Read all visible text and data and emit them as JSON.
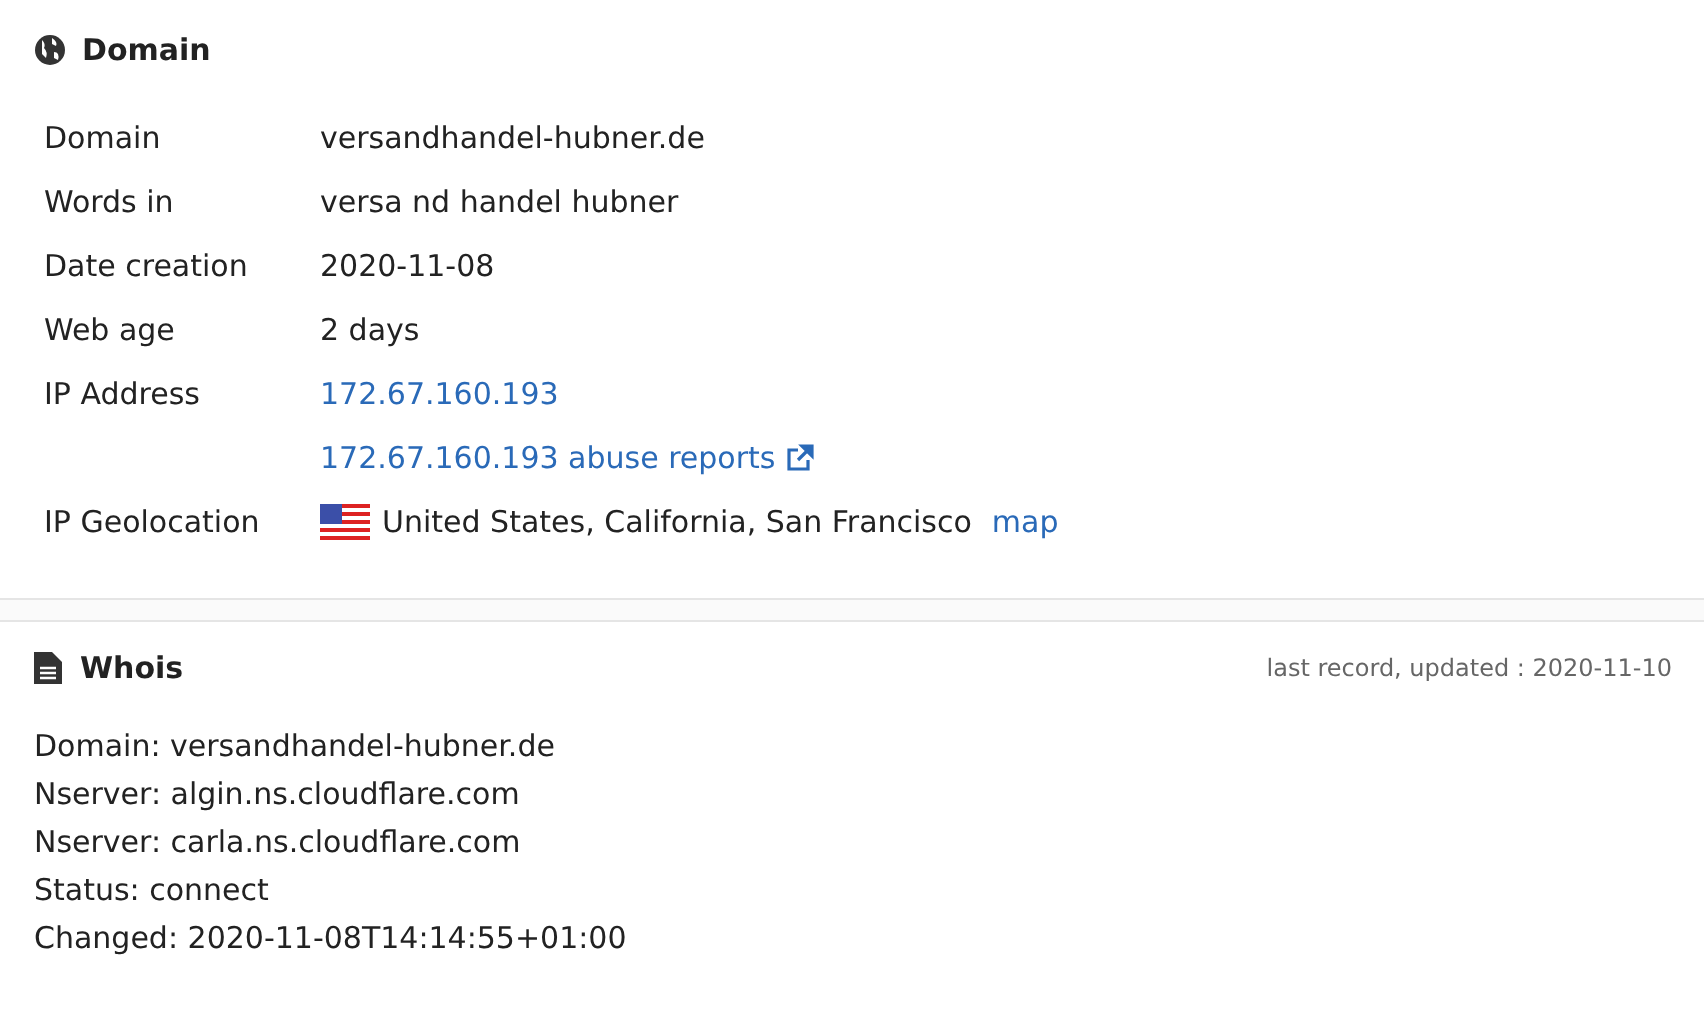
{
  "domain_card": {
    "title": "Domain",
    "rows": [
      {
        "kind": "text",
        "label": "Domain",
        "value": "versandhandel-hubner.de"
      },
      {
        "kind": "text",
        "label": "Words in",
        "value": "versa nd handel hubner"
      },
      {
        "kind": "text",
        "label": "Date creation",
        "value": "2020-11-08"
      },
      {
        "kind": "text",
        "label": "Web age",
        "value": "2 days"
      },
      {
        "kind": "link",
        "label": "IP Address",
        "value": "172.67.160.193"
      },
      {
        "kind": "external_link",
        "value": "172.67.160.193 abuse reports"
      },
      {
        "kind": "geo",
        "label": "IP Geolocation",
        "value": "United States, California, San Francisco",
        "link": "map"
      }
    ]
  },
  "whois_card": {
    "title": "Whois",
    "note": "last record, updated : 2020-11-10",
    "lines": [
      "Domain: versandhandel-hubner.de",
      "Nserver: algin.ns.cloudflare.com",
      "Nserver: carla.ns.cloudflare.com",
      "Status: connect",
      "Changed: 2020-11-08T14:14:55+01:00"
    ]
  }
}
